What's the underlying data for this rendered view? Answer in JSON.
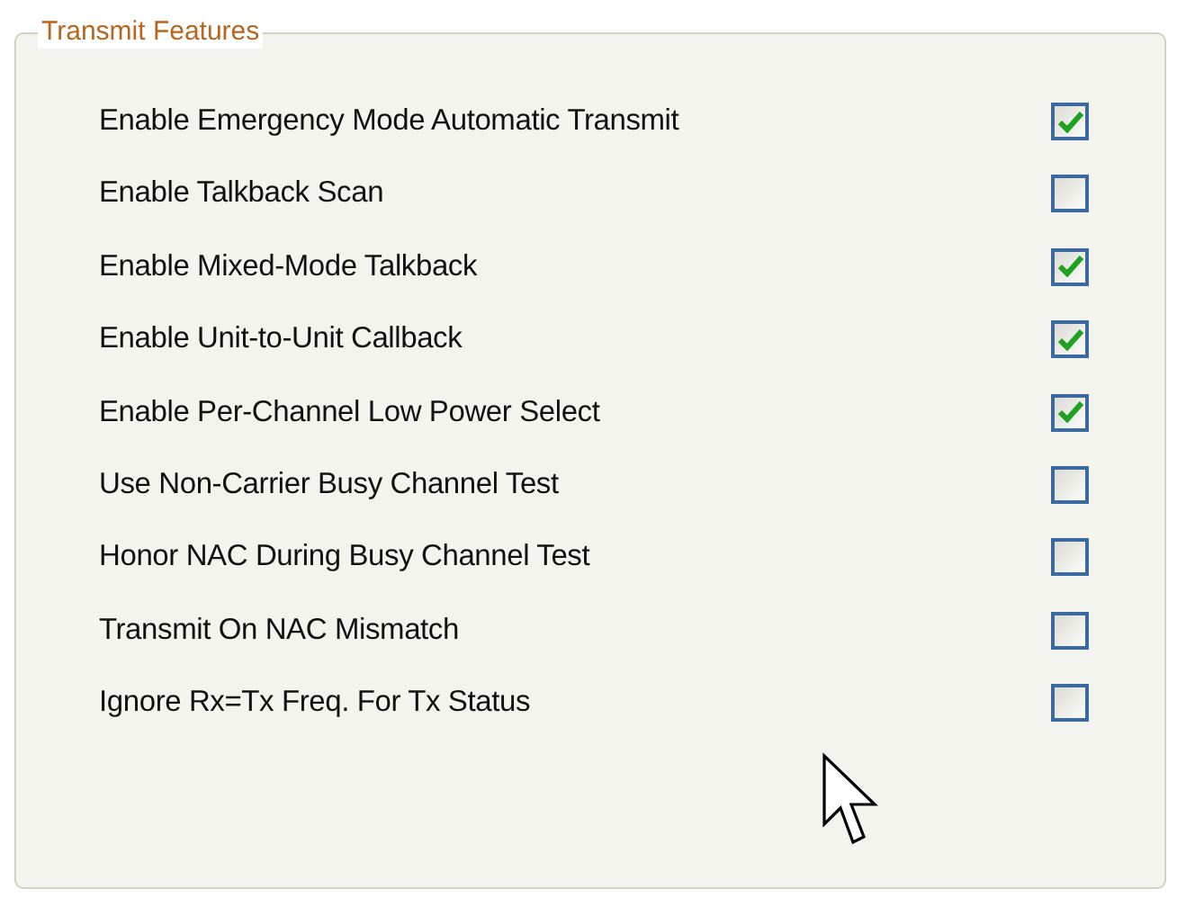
{
  "group": {
    "title": "Transmit Features",
    "options": [
      {
        "label": "Enable Emergency Mode Automatic Transmit",
        "checked": true
      },
      {
        "label": "Enable Talkback Scan",
        "checked": false
      },
      {
        "label": "Enable Mixed-Mode Talkback",
        "checked": true
      },
      {
        "label": "Enable Unit-to-Unit Callback",
        "checked": true
      },
      {
        "label": "Enable Per-Channel Low Power Select",
        "checked": true
      },
      {
        "label": "Use Non-Carrier Busy Channel Test",
        "checked": false
      },
      {
        "label": "Honor NAC During Busy Channel Test",
        "checked": false
      },
      {
        "label": "Transmit On NAC Mismatch",
        "checked": false
      },
      {
        "label": "Ignore Rx=Tx Freq. For Tx Status",
        "checked": false
      }
    ]
  }
}
